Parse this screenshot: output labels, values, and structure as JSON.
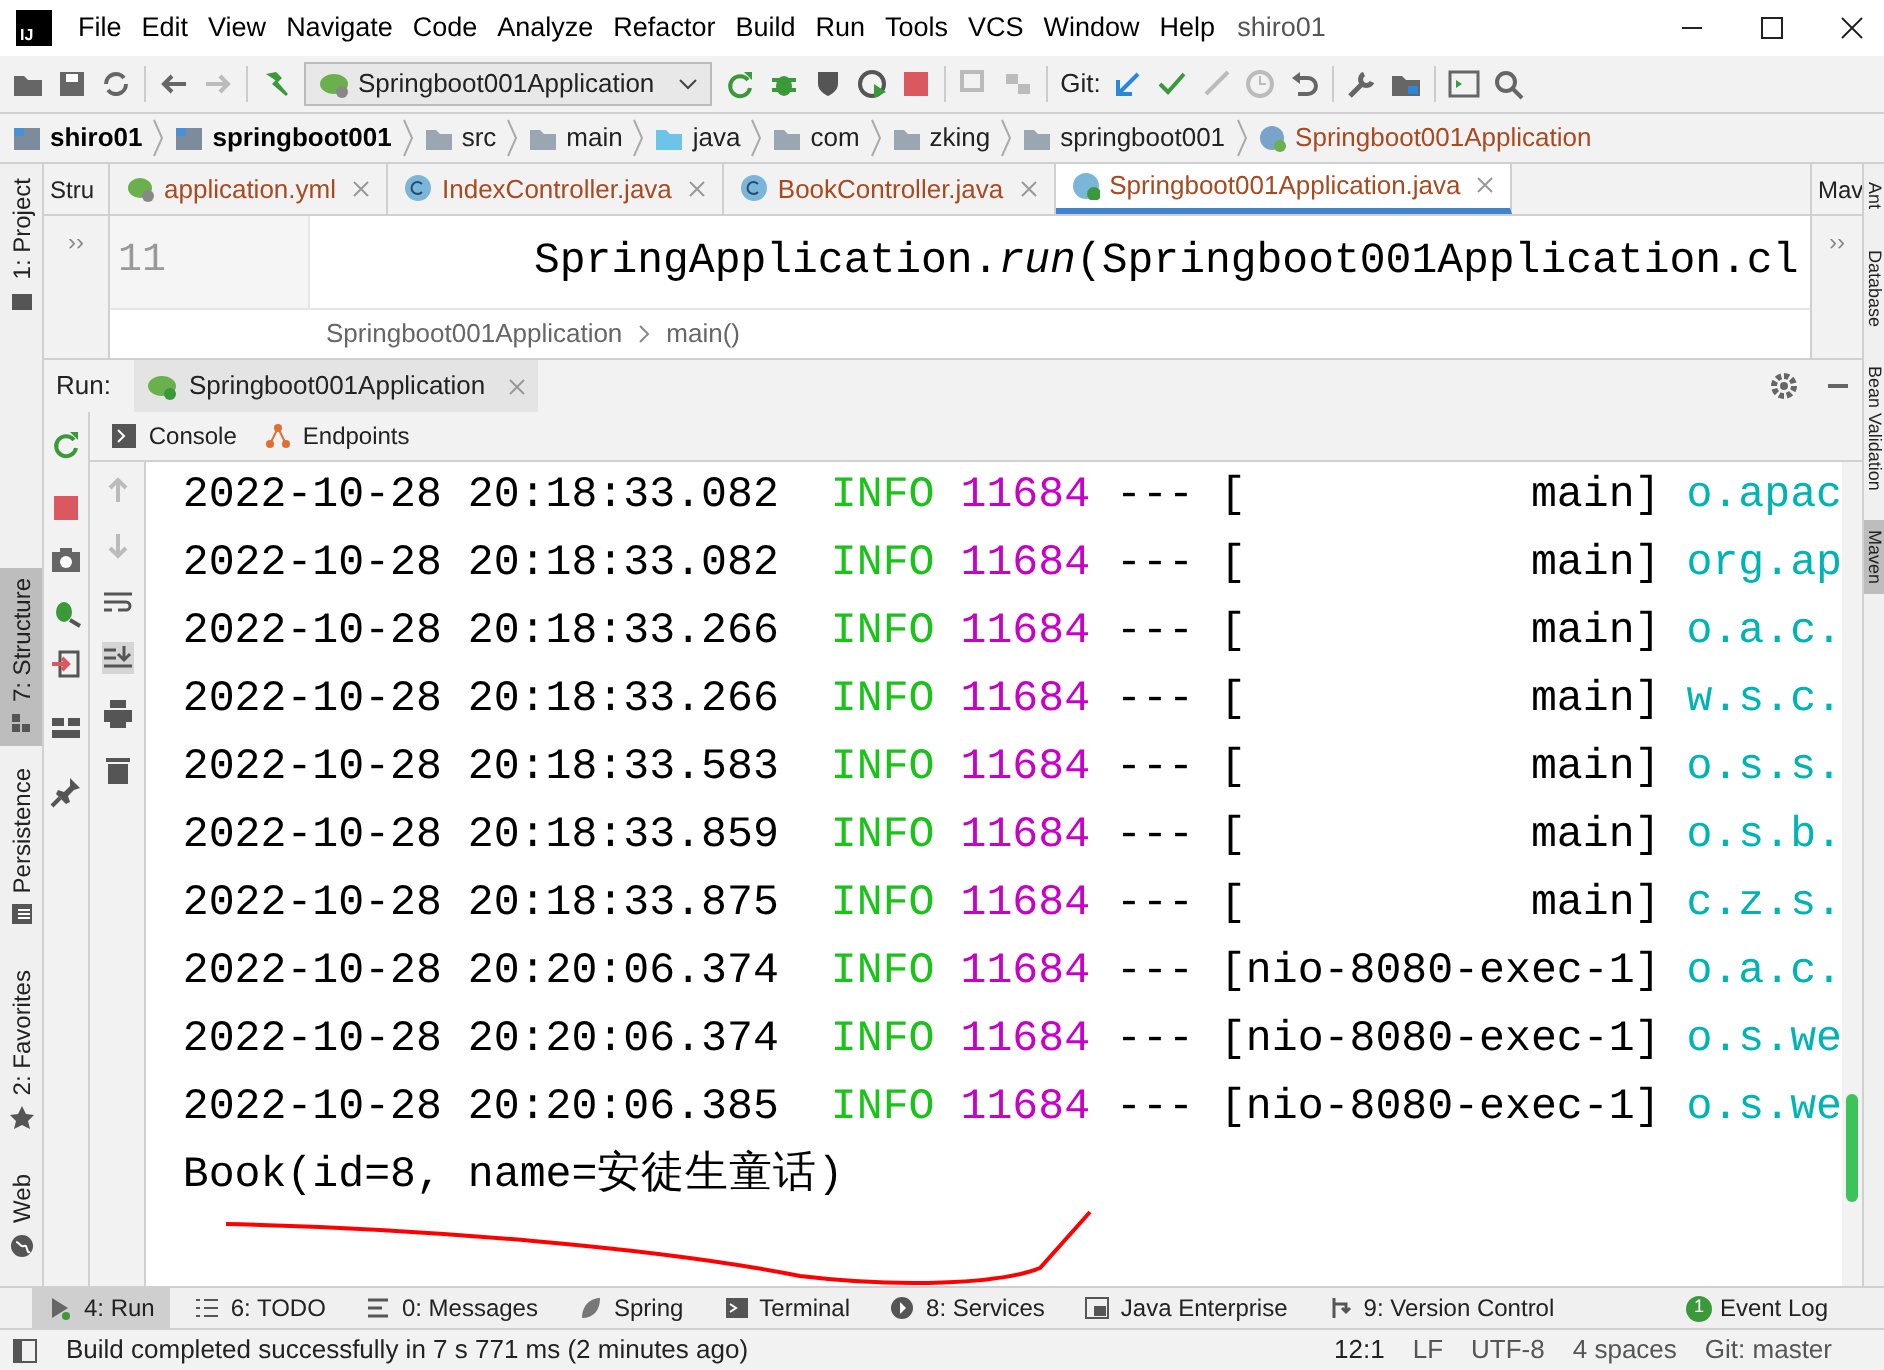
{
  "logo_text": "IJ",
  "menu": [
    "File",
    "Edit",
    "View",
    "Navigate",
    "Code",
    "Analyze",
    "Refactor",
    "Build",
    "Run",
    "Tools",
    "VCS",
    "Window",
    "Help"
  ],
  "title": "shiro01",
  "toolbar": {
    "run_config": "Springboot001Application",
    "git_label": "Git:"
  },
  "breadcrumbs": [
    {
      "label": "shiro01",
      "kind": "module"
    },
    {
      "label": "springboot001",
      "kind": "module"
    },
    {
      "label": "src",
      "kind": "folder"
    },
    {
      "label": "main",
      "kind": "folder"
    },
    {
      "label": "java",
      "kind": "source"
    },
    {
      "label": "com",
      "kind": "folder"
    },
    {
      "label": "zking",
      "kind": "folder"
    },
    {
      "label": "springboot001",
      "kind": "folder"
    },
    {
      "label": "Springboot001Application",
      "kind": "class"
    }
  ],
  "left_tool_tabs": [
    {
      "label": "1: Project",
      "kind": "project",
      "selected": false
    },
    {
      "label": "7: Structure",
      "kind": "structure",
      "selected": true
    },
    {
      "label": "Persistence",
      "kind": "persistence",
      "selected": false
    },
    {
      "label": "2: Favorites",
      "kind": "favorites",
      "selected": false
    },
    {
      "label": "Web",
      "kind": "web",
      "selected": false
    }
  ],
  "right_tool_tabs": [
    {
      "label": "Ant",
      "selected": false
    },
    {
      "label": "Database",
      "selected": false
    },
    {
      "label": "Bean Validation",
      "selected": false
    },
    {
      "label": "Maven",
      "selected": true
    }
  ],
  "editor_tabs": [
    {
      "label": "application.yml",
      "kind": "yml",
      "selected": false
    },
    {
      "label": "IndexController.java",
      "kind": "class",
      "selected": false
    },
    {
      "label": "BookController.java",
      "kind": "class",
      "selected": false
    },
    {
      "label": "Springboot001Application.java",
      "kind": "app",
      "selected": true
    }
  ],
  "structure_panel": {
    "title": "Stru",
    "expand": "››"
  },
  "maven_panel": {
    "title": "Mav",
    "expand": "››"
  },
  "editor": {
    "line_number": "11",
    "code": "SpringApplication.*run*(Springboot001Application.cl",
    "breadcrumb": [
      "Springboot001Application",
      "main()"
    ]
  },
  "run_panel": {
    "label": "Run:",
    "tab": "Springboot001Application",
    "subtabs": [
      {
        "label": "Console",
        "kind": "console"
      },
      {
        "label": "Endpoints",
        "kind": "endpoints"
      }
    ],
    "log_rows": [
      {
        "timestamp": "2022-10-28 20:18:33.082",
        "level": "INFO",
        "pid": "11684",
        "sep": "---",
        "thread": "[           main]",
        "logger": "o.apac"
      },
      {
        "timestamp": "2022-10-28 20:18:33.082",
        "level": "INFO",
        "pid": "11684",
        "sep": "---",
        "thread": "[           main]",
        "logger": "org.ap"
      },
      {
        "timestamp": "2022-10-28 20:18:33.266",
        "level": "INFO",
        "pid": "11684",
        "sep": "---",
        "thread": "[           main]",
        "logger": "o.a.c."
      },
      {
        "timestamp": "2022-10-28 20:18:33.266",
        "level": "INFO",
        "pid": "11684",
        "sep": "---",
        "thread": "[           main]",
        "logger": "w.s.c."
      },
      {
        "timestamp": "2022-10-28 20:18:33.583",
        "level": "INFO",
        "pid": "11684",
        "sep": "---",
        "thread": "[           main]",
        "logger": "o.s.s."
      },
      {
        "timestamp": "2022-10-28 20:18:33.859",
        "level": "INFO",
        "pid": "11684",
        "sep": "---",
        "thread": "[           main]",
        "logger": "o.s.b."
      },
      {
        "timestamp": "2022-10-28 20:18:33.875",
        "level": "INFO",
        "pid": "11684",
        "sep": "---",
        "thread": "[           main]",
        "logger": "c.z.s."
      },
      {
        "timestamp": "2022-10-28 20:20:06.374",
        "level": "INFO",
        "pid": "11684",
        "sep": "---",
        "thread": "[nio-8080-exec-1]",
        "logger": "o.a.c."
      },
      {
        "timestamp": "2022-10-28 20:20:06.374",
        "level": "INFO",
        "pid": "11684",
        "sep": "---",
        "thread": "[nio-8080-exec-1]",
        "logger": "o.s.we"
      },
      {
        "timestamp": "2022-10-28 20:20:06.385",
        "level": "INFO",
        "pid": "11684",
        "sep": "---",
        "thread": "[nio-8080-exec-1]",
        "logger": "o.s.we"
      }
    ],
    "output": "Book(id=8, name=安徒生童话)"
  },
  "bottom_tabs": [
    {
      "label": "4: Run",
      "kind": "run",
      "selected": true
    },
    {
      "label": "6: TODO",
      "kind": "todo",
      "selected": false
    },
    {
      "label": "0: Messages",
      "kind": "messages",
      "selected": false
    },
    {
      "label": "Spring",
      "kind": "spring",
      "selected": false
    },
    {
      "label": "Terminal",
      "kind": "terminal",
      "selected": false
    },
    {
      "label": "8: Services",
      "kind": "services",
      "selected": false
    },
    {
      "label": "Java Enterprise",
      "kind": "enterprise",
      "selected": false
    },
    {
      "label": "9: Version Control",
      "kind": "vcs",
      "selected": false
    }
  ],
  "event_log": {
    "label": "Event Log",
    "count": "1"
  },
  "status_bar": {
    "message": "Build completed successfully in 7 s 771 ms (2 minutes ago)",
    "position": "12:1",
    "line_separator": "LF",
    "encoding": "UTF-8",
    "indent": "4 spaces",
    "vcs_branch": "Git: master"
  }
}
